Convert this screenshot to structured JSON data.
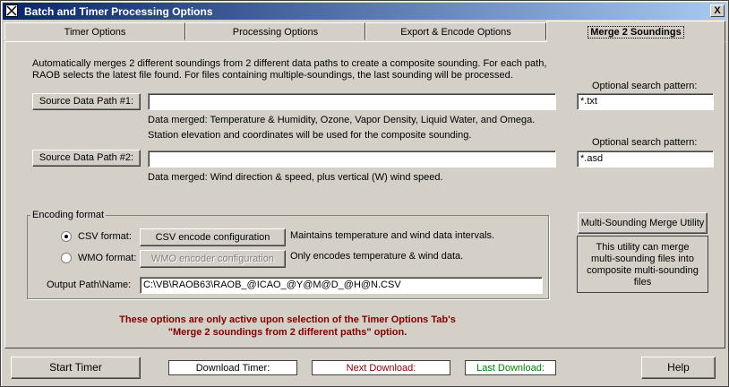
{
  "window": {
    "title": "Batch and Timer Processing Options",
    "close_label": "X"
  },
  "tabs": [
    {
      "label": "Timer Options"
    },
    {
      "label": "Processing Options"
    },
    {
      "label": "Export & Encode Options"
    },
    {
      "label": "Merge 2 Soundings",
      "active": true
    }
  ],
  "intro": {
    "line1": "Automatically merges 2 different soundings from 2 different data paths to create a composite sounding.  For each path,",
    "line2": "RAOB selects the latest file found.  For files containing multiple-soundings, the last sounding will be processed."
  },
  "path1": {
    "button_label": "Source Data Path #1:",
    "value": "",
    "pattern_label": "Optional search pattern:",
    "pattern_value": "*.txt",
    "note1": "Data merged: Temperature & Humidity, Ozone, Vapor Density, Liquid Water, and Omega.",
    "note2": "Station elevation and coordinates will be used for the composite sounding."
  },
  "path2": {
    "button_label": "Source Data Path #2:",
    "value": "",
    "pattern_label": "Optional search pattern:",
    "pattern_value": "*.asd",
    "note1": "Data merged: Wind direction & speed, plus vertical (W) wind speed."
  },
  "encoding": {
    "group_label": "Encoding format",
    "csv_label": "CSV format:",
    "csv_selected": true,
    "csv_button": "CSV encode configuration",
    "csv_desc": "Maintains temperature and wind data intervals.",
    "wmo_label": "WMO format:",
    "wmo_selected": false,
    "wmo_button": "WMO encoder configuration",
    "wmo_desc": "Only encodes temperature & wind data.",
    "output_label": "Output Path\\Name:",
    "output_value": "C:\\VB\\RAOB63\\RAOB_@ICAO_@Y@M@D_@H@N.CSV"
  },
  "utility": {
    "button_label": "Multi-Sounding Merge Utility",
    "line1": "This utility can merge",
    "line2": "multi-sounding files into",
    "line3": "composite multi-sounding files"
  },
  "warning": {
    "line1": "These options are only active upon selection of the Timer Options Tab's",
    "line2": "\"Merge 2 soundings from 2 different paths\" option."
  },
  "footer": {
    "start_timer": "Start Timer",
    "download_timer": "Download Timer:",
    "next_download": "Next Download:",
    "last_download": "Last Download:",
    "help": "Help",
    "colors": {
      "next": "#800000",
      "last": "#008000"
    }
  }
}
